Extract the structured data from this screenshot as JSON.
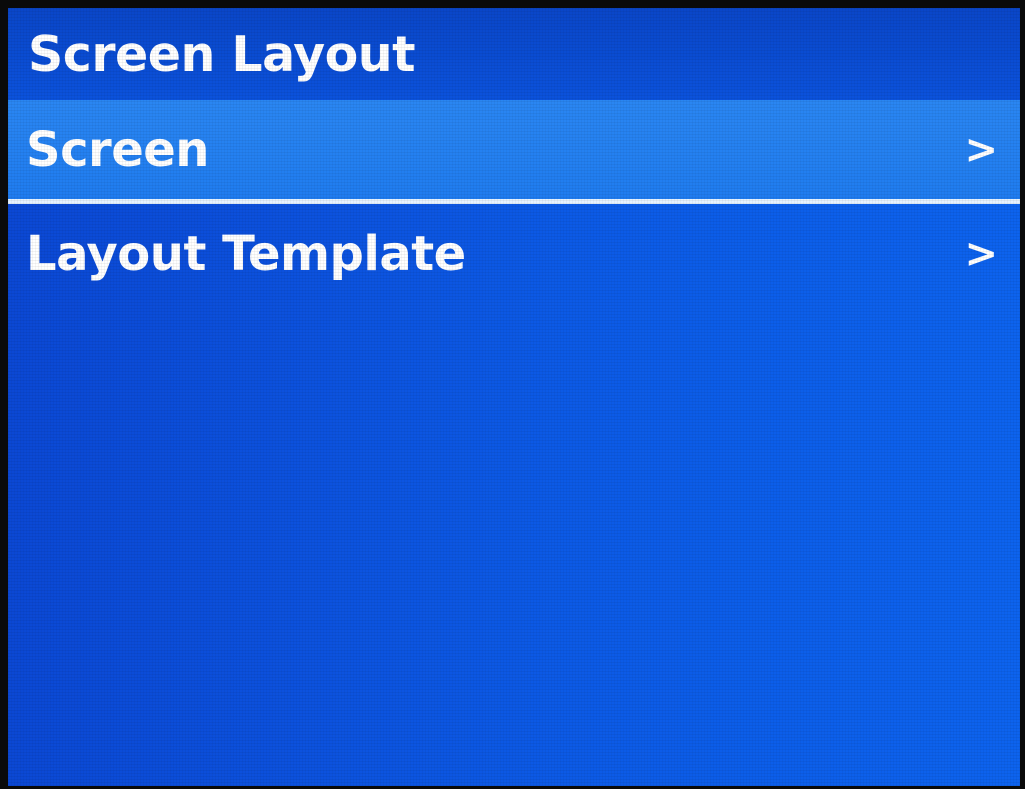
{
  "header": {
    "title": "Screen Layout"
  },
  "menu": {
    "items": [
      {
        "label": "Screen",
        "arrow": ">",
        "selected": true
      },
      {
        "label": "Layout Template",
        "arrow": ">",
        "selected": false
      }
    ]
  },
  "colors": {
    "background": "#0c5ae6",
    "selected_row": "#2a86f2",
    "text": "#ffffff"
  },
  "icons": {
    "chevron": "chevron-right-icon"
  }
}
